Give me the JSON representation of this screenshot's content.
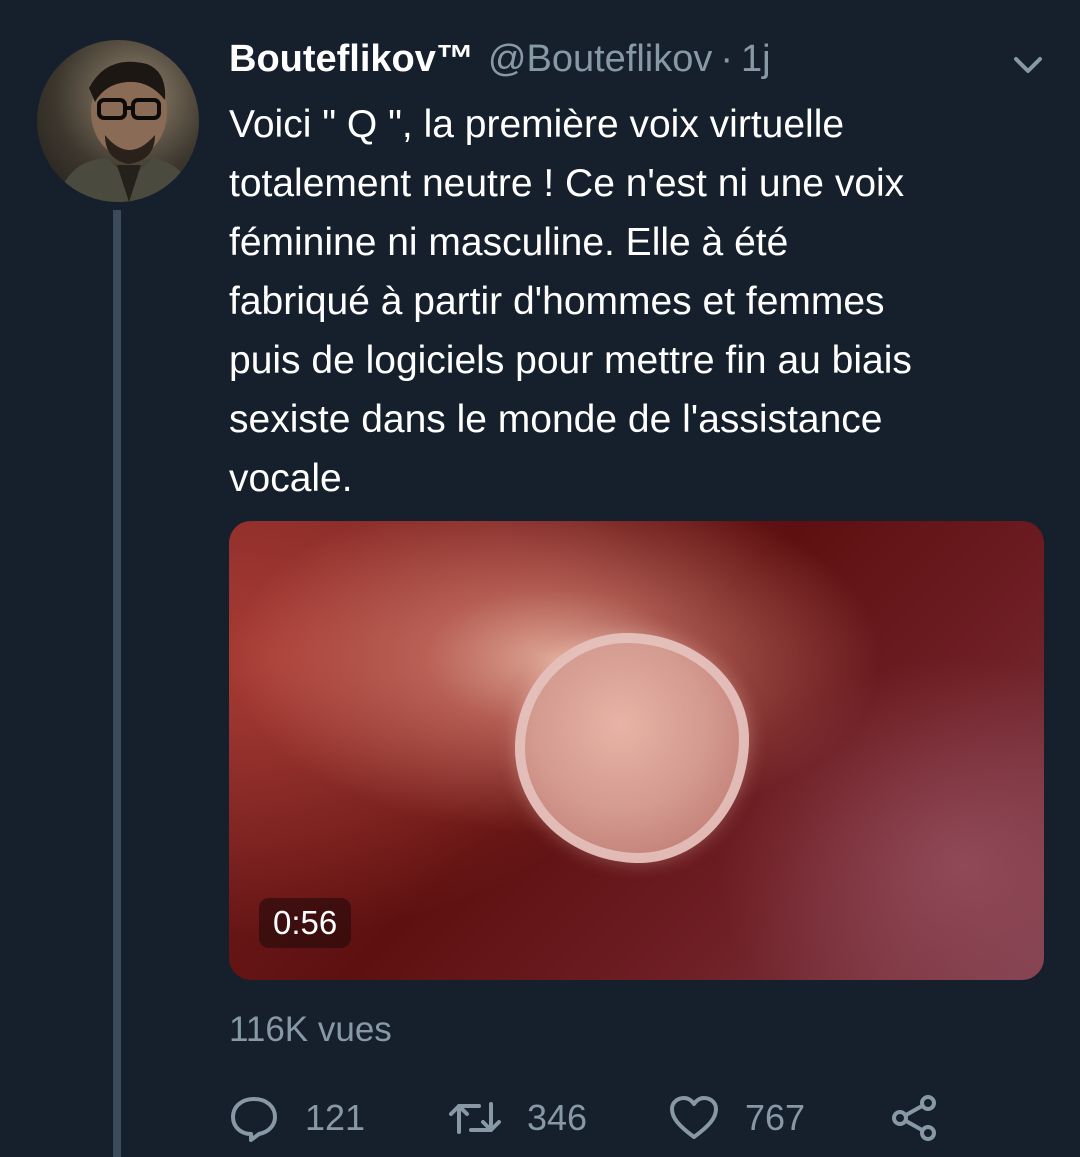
{
  "user": {
    "display_name": "Bouteflikov™",
    "handle": "@Bouteflikov",
    "separator": "·",
    "time": "1j"
  },
  "tweet": {
    "text": "Voici \" Q \", la première voix virtuelle\ntotalement neutre ! Ce n'est ni une voix\nféminine ni masculine. Elle à été\nfabriqué à partir d'hommes et femmes\npuis de logiciels pour mettre fin au biais\nsexiste dans le monde de l'assistance\nvocale."
  },
  "media": {
    "duration": "0:56"
  },
  "stats": {
    "views": "116K vues"
  },
  "actions": {
    "reply_count": "121",
    "retweet_count": "346",
    "like_count": "767"
  },
  "icons": {
    "menu": "chevron-down-icon",
    "reply": "reply-icon",
    "retweet": "retweet-icon",
    "like": "heart-icon",
    "share": "share-icon"
  },
  "colors": {
    "background": "#16202c",
    "secondary_text": "#8899a6",
    "thread_line": "#3c4b5b"
  }
}
